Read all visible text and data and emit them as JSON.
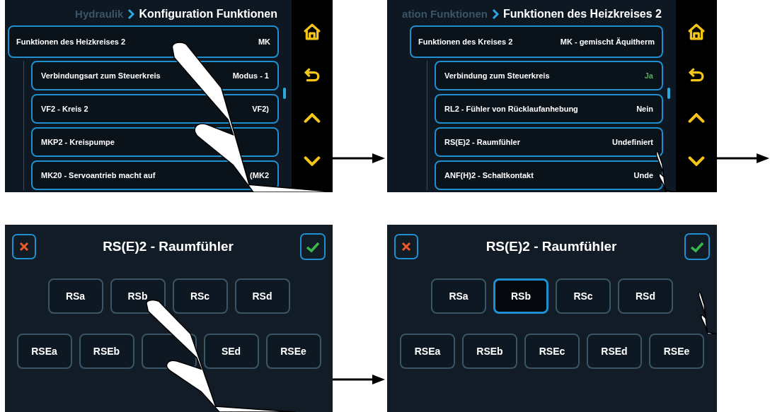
{
  "panels": [
    {
      "kind": "list",
      "breadcrumb": {
        "parent": "Hydraulik",
        "current": "Konfiguration Funktionen"
      },
      "header_row": {
        "label": "Funktionen des Heizkreises 2",
        "value": "MK"
      },
      "rows": [
        {
          "label": "Verbindungsart zum Steuerkreis",
          "value": "Modus - 1",
          "color": "#ffffff"
        },
        {
          "label": "VF2 - Kreis 2",
          "value": "VF2)",
          "color": "#ffffff"
        },
        {
          "label": "MKP2 - Kreispumpe"
        },
        {
          "label": "MK20 - Servoantrieb macht auf",
          "value": "(MK2",
          "color": "#ffffff"
        }
      ]
    },
    {
      "kind": "list",
      "breadcrumb": {
        "parent": "ation Funktionen",
        "current": "Funktionen des Heizkreises 2"
      },
      "header_row": {
        "label": "Funktionen des Kreises 2",
        "value": "MK - gemischt Äquitherm"
      },
      "rows": [
        {
          "label": "Verbindung zum Steuerkreis",
          "value": "Ja",
          "color": "#4caf50"
        },
        {
          "label": "RL2 - Fühler von Rücklaufanhebung",
          "value": "Nein",
          "color": "#ffffff"
        },
        {
          "label": "RS(E)2 - Raumfühler",
          "value": "Undefiniert",
          "color": "#ffffff"
        },
        {
          "label": "ANF(H)2 - Schaltkontakt",
          "value": "Unde",
          "color": "#ffffff"
        }
      ]
    },
    {
      "kind": "dialog",
      "title": "RS(E)2 - Raumfühler",
      "option_rows": [
        [
          {
            "label": "RSa",
            "selected": false
          },
          {
            "label": "RSb",
            "selected": false
          },
          {
            "label": "RSc",
            "selected": false
          },
          {
            "label": "RSd",
            "selected": false
          }
        ],
        [
          {
            "label": "RSEa",
            "selected": false
          },
          {
            "label": "RSEb",
            "selected": false
          },
          {
            "selected": false
          },
          {
            "label": "SEd",
            "selected": false
          },
          {
            "label": "RSEe",
            "selected": false
          }
        ]
      ]
    },
    {
      "kind": "dialog",
      "title": "RS(E)2 - Raumfühler",
      "option_rows": [
        [
          {
            "label": "RSa",
            "selected": false
          },
          {
            "label": "RSb",
            "selected": true
          },
          {
            "label": "RSc",
            "selected": false
          },
          {
            "label": "RSd",
            "selected": false
          }
        ],
        [
          {
            "label": "RSEa",
            "selected": false
          },
          {
            "label": "RSEb",
            "selected": false
          },
          {
            "label": "RSEc",
            "selected": false
          },
          {
            "label": "RSEd",
            "selected": false
          },
          {
            "label": "RSEe",
            "selected": false
          }
        ]
      ]
    }
  ]
}
